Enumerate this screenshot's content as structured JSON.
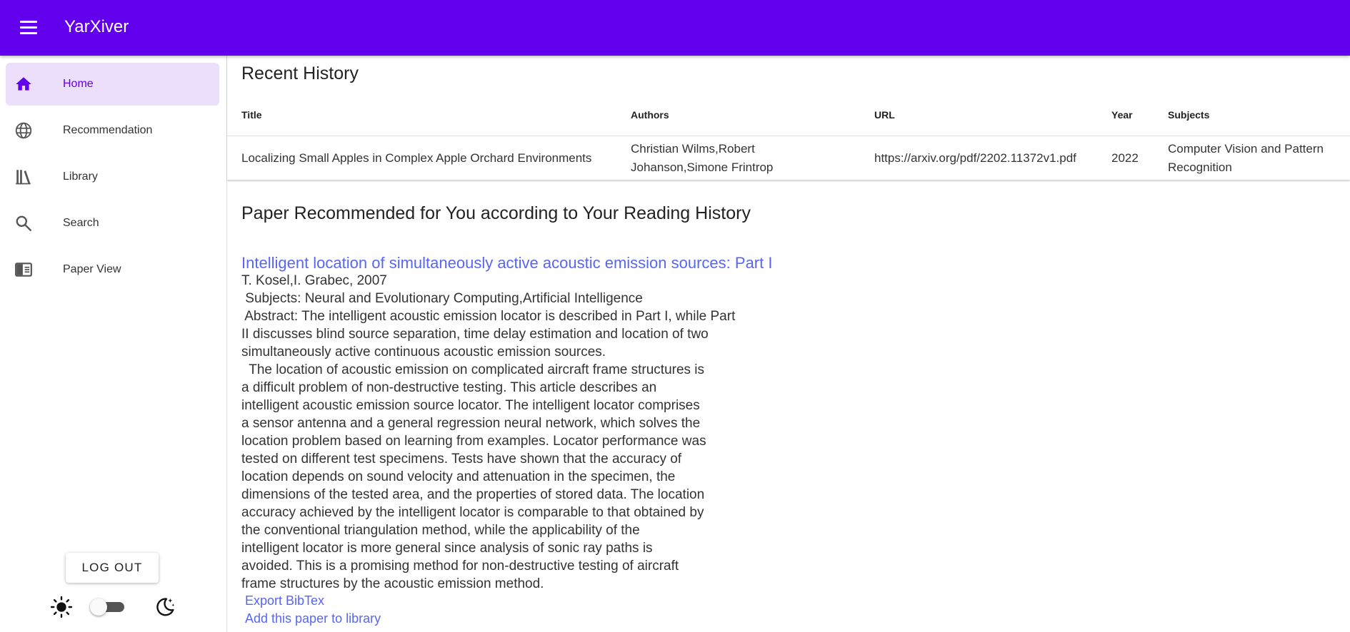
{
  "app": {
    "title": "YarXiver",
    "menu_icon": "menu-icon"
  },
  "colors": {
    "primary": "#6200ee",
    "active_nav_bg": "#ebdffb",
    "link": "#5866f0"
  },
  "sidebar": {
    "items": [
      {
        "label": "Home",
        "icon": "home-icon",
        "active": true
      },
      {
        "label": "Recommendation",
        "icon": "globe-icon",
        "active": false
      },
      {
        "label": "Library",
        "icon": "library-icon",
        "active": false
      },
      {
        "label": "Search",
        "icon": "search-icon",
        "active": false
      },
      {
        "label": "Paper View",
        "icon": "paper-view-icon",
        "active": false
      }
    ],
    "logout_label": "LOG OUT",
    "theme": {
      "light_icon": "sun-icon",
      "dark_icon": "moon-icon",
      "dark_mode": false
    }
  },
  "history": {
    "title": "Recent History",
    "columns": [
      "Title",
      "Authors",
      "URL",
      "Year",
      "Subjects"
    ],
    "rows": [
      {
        "title": "Localizing Small Apples in Complex Apple Orchard Environments",
        "authors_line1": "Christian Wilms,Robert",
        "authors_line2": "Johanson,Simone Frintrop",
        "url": "https://arxiv.org/pdf/2202.11372v1.pdf",
        "year": "2022",
        "subjects_line1": "Computer Vision and Pattern",
        "subjects_line2": "Recognition"
      }
    ]
  },
  "recommendation": {
    "title": "Paper Recommended for You according to Your Reading History",
    "paper": {
      "title": "Intelligent location of simultaneously active acoustic emission sources: Part I",
      "byline": "T. Kosel,I. Grabec, 2007",
      "subjects": " Subjects: Neural and Evolutionary Computing,Artificial Intelligence",
      "abstract_lines": [
        " Abstract: The intelligent acoustic emission locator is described in Part I, while Part",
        "II discusses blind source separation, time delay estimation and location of two",
        "simultaneously active continuous acoustic emission sources.",
        "  The location of acoustic emission on complicated aircraft frame structures is",
        "a difficult problem of non-destructive testing. This article describes an",
        "intelligent acoustic emission source locator. The intelligent locator comprises",
        "a sensor antenna and a general regression neural network, which solves the",
        "location problem based on learning from examples. Locator performance was",
        "tested on different test specimens. Tests have shown that the accuracy of",
        "location depends on sound velocity and attenuation in the specimen, the",
        "dimensions of the tested area, and the properties of stored data. The location",
        "accuracy achieved by the intelligent locator is comparable to that obtained by",
        "the conventional triangulation method, while the applicability of the",
        "intelligent locator is more general since analysis of sonic ray paths is",
        "avoided. This is a promising method for non-destructive testing of aircraft",
        "frame structures by the acoustic emission method."
      ],
      "export_label": "Export BibTex",
      "add_label": "Add this paper to library"
    }
  }
}
